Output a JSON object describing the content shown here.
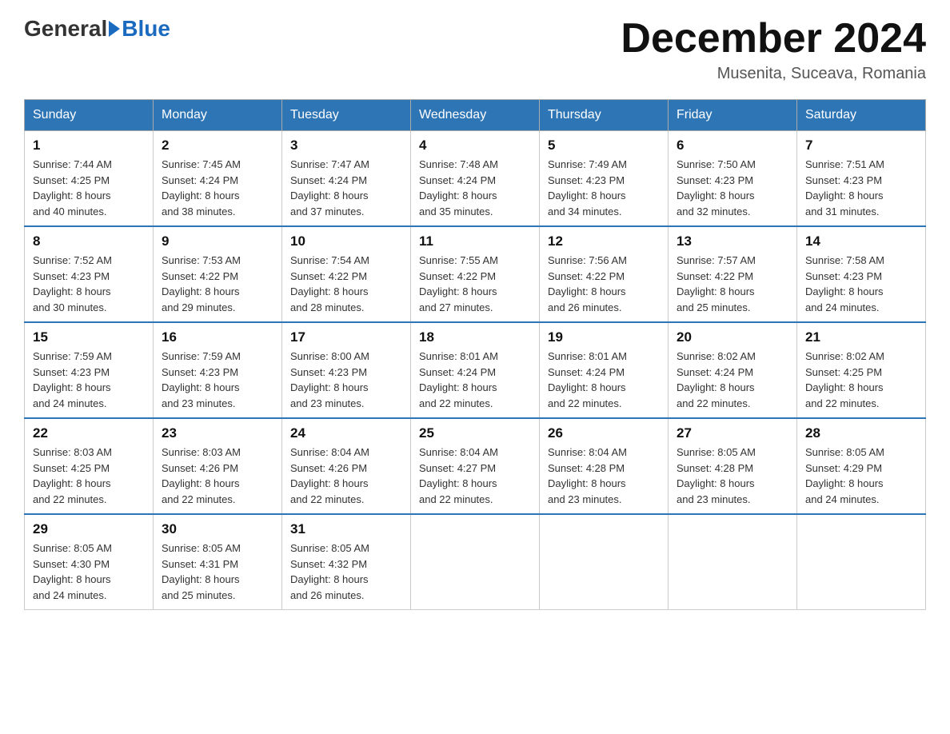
{
  "header": {
    "logo_general": "General",
    "logo_blue": "Blue",
    "month_title": "December 2024",
    "location": "Musenita, Suceava, Romania"
  },
  "days_of_week": [
    "Sunday",
    "Monday",
    "Tuesday",
    "Wednesday",
    "Thursday",
    "Friday",
    "Saturday"
  ],
  "weeks": [
    [
      {
        "day": "1",
        "sunrise": "7:44 AM",
        "sunset": "4:25 PM",
        "daylight": "8 hours and 40 minutes."
      },
      {
        "day": "2",
        "sunrise": "7:45 AM",
        "sunset": "4:24 PM",
        "daylight": "8 hours and 38 minutes."
      },
      {
        "day": "3",
        "sunrise": "7:47 AM",
        "sunset": "4:24 PM",
        "daylight": "8 hours and 37 minutes."
      },
      {
        "day": "4",
        "sunrise": "7:48 AM",
        "sunset": "4:24 PM",
        "daylight": "8 hours and 35 minutes."
      },
      {
        "day": "5",
        "sunrise": "7:49 AM",
        "sunset": "4:23 PM",
        "daylight": "8 hours and 34 minutes."
      },
      {
        "day": "6",
        "sunrise": "7:50 AM",
        "sunset": "4:23 PM",
        "daylight": "8 hours and 32 minutes."
      },
      {
        "day": "7",
        "sunrise": "7:51 AM",
        "sunset": "4:23 PM",
        "daylight": "8 hours and 31 minutes."
      }
    ],
    [
      {
        "day": "8",
        "sunrise": "7:52 AM",
        "sunset": "4:23 PM",
        "daylight": "8 hours and 30 minutes."
      },
      {
        "day": "9",
        "sunrise": "7:53 AM",
        "sunset": "4:22 PM",
        "daylight": "8 hours and 29 minutes."
      },
      {
        "day": "10",
        "sunrise": "7:54 AM",
        "sunset": "4:22 PM",
        "daylight": "8 hours and 28 minutes."
      },
      {
        "day": "11",
        "sunrise": "7:55 AM",
        "sunset": "4:22 PM",
        "daylight": "8 hours and 27 minutes."
      },
      {
        "day": "12",
        "sunrise": "7:56 AM",
        "sunset": "4:22 PM",
        "daylight": "8 hours and 26 minutes."
      },
      {
        "day": "13",
        "sunrise": "7:57 AM",
        "sunset": "4:22 PM",
        "daylight": "8 hours and 25 minutes."
      },
      {
        "day": "14",
        "sunrise": "7:58 AM",
        "sunset": "4:23 PM",
        "daylight": "8 hours and 24 minutes."
      }
    ],
    [
      {
        "day": "15",
        "sunrise": "7:59 AM",
        "sunset": "4:23 PM",
        "daylight": "8 hours and 24 minutes."
      },
      {
        "day": "16",
        "sunrise": "7:59 AM",
        "sunset": "4:23 PM",
        "daylight": "8 hours and 23 minutes."
      },
      {
        "day": "17",
        "sunrise": "8:00 AM",
        "sunset": "4:23 PM",
        "daylight": "8 hours and 23 minutes."
      },
      {
        "day": "18",
        "sunrise": "8:01 AM",
        "sunset": "4:24 PM",
        "daylight": "8 hours and 22 minutes."
      },
      {
        "day": "19",
        "sunrise": "8:01 AM",
        "sunset": "4:24 PM",
        "daylight": "8 hours and 22 minutes."
      },
      {
        "day": "20",
        "sunrise": "8:02 AM",
        "sunset": "4:24 PM",
        "daylight": "8 hours and 22 minutes."
      },
      {
        "day": "21",
        "sunrise": "8:02 AM",
        "sunset": "4:25 PM",
        "daylight": "8 hours and 22 minutes."
      }
    ],
    [
      {
        "day": "22",
        "sunrise": "8:03 AM",
        "sunset": "4:25 PM",
        "daylight": "8 hours and 22 minutes."
      },
      {
        "day": "23",
        "sunrise": "8:03 AM",
        "sunset": "4:26 PM",
        "daylight": "8 hours and 22 minutes."
      },
      {
        "day": "24",
        "sunrise": "8:04 AM",
        "sunset": "4:26 PM",
        "daylight": "8 hours and 22 minutes."
      },
      {
        "day": "25",
        "sunrise": "8:04 AM",
        "sunset": "4:27 PM",
        "daylight": "8 hours and 22 minutes."
      },
      {
        "day": "26",
        "sunrise": "8:04 AM",
        "sunset": "4:28 PM",
        "daylight": "8 hours and 23 minutes."
      },
      {
        "day": "27",
        "sunrise": "8:05 AM",
        "sunset": "4:28 PM",
        "daylight": "8 hours and 23 minutes."
      },
      {
        "day": "28",
        "sunrise": "8:05 AM",
        "sunset": "4:29 PM",
        "daylight": "8 hours and 24 minutes."
      }
    ],
    [
      {
        "day": "29",
        "sunrise": "8:05 AM",
        "sunset": "4:30 PM",
        "daylight": "8 hours and 24 minutes."
      },
      {
        "day": "30",
        "sunrise": "8:05 AM",
        "sunset": "4:31 PM",
        "daylight": "8 hours and 25 minutes."
      },
      {
        "day": "31",
        "sunrise": "8:05 AM",
        "sunset": "4:32 PM",
        "daylight": "8 hours and 26 minutes."
      },
      null,
      null,
      null,
      null
    ]
  ],
  "labels": {
    "sunrise": "Sunrise:",
    "sunset": "Sunset:",
    "daylight": "Daylight:"
  }
}
